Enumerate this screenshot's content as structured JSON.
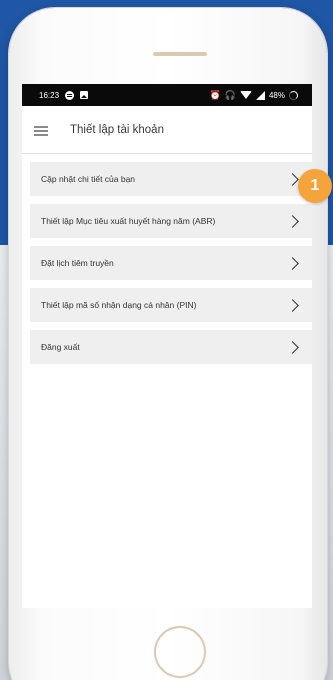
{
  "status_bar": {
    "time": "16:23",
    "battery_percent": "48%",
    "icons": [
      "spotify-icon",
      "image-icon",
      "alarm-icon",
      "headphones-icon",
      "wifi-icon",
      "signal-icon",
      "battery-icon"
    ]
  },
  "app_bar": {
    "title": "Thiết lập tài khoản",
    "menu_icon": "hamburger-menu-icon"
  },
  "menu": {
    "items": [
      {
        "label": "Cập nhật chi tiết của bạn"
      },
      {
        "label": "Thiết lập Mục tiêu xuất huyết hàng năm (ABR)"
      },
      {
        "label": "Đặt lịch tiêm truyền"
      },
      {
        "label": "Thiết lập mã số nhận dạng cá nhân (PIN)"
      },
      {
        "label": "Đăng xuất"
      }
    ]
  },
  "callout": {
    "step": "1",
    "color": "#f5a43c"
  },
  "colors": {
    "background_top": "#1f56a5",
    "status_bar": "#0a0a0a",
    "list_item_bg": "#efefef"
  }
}
